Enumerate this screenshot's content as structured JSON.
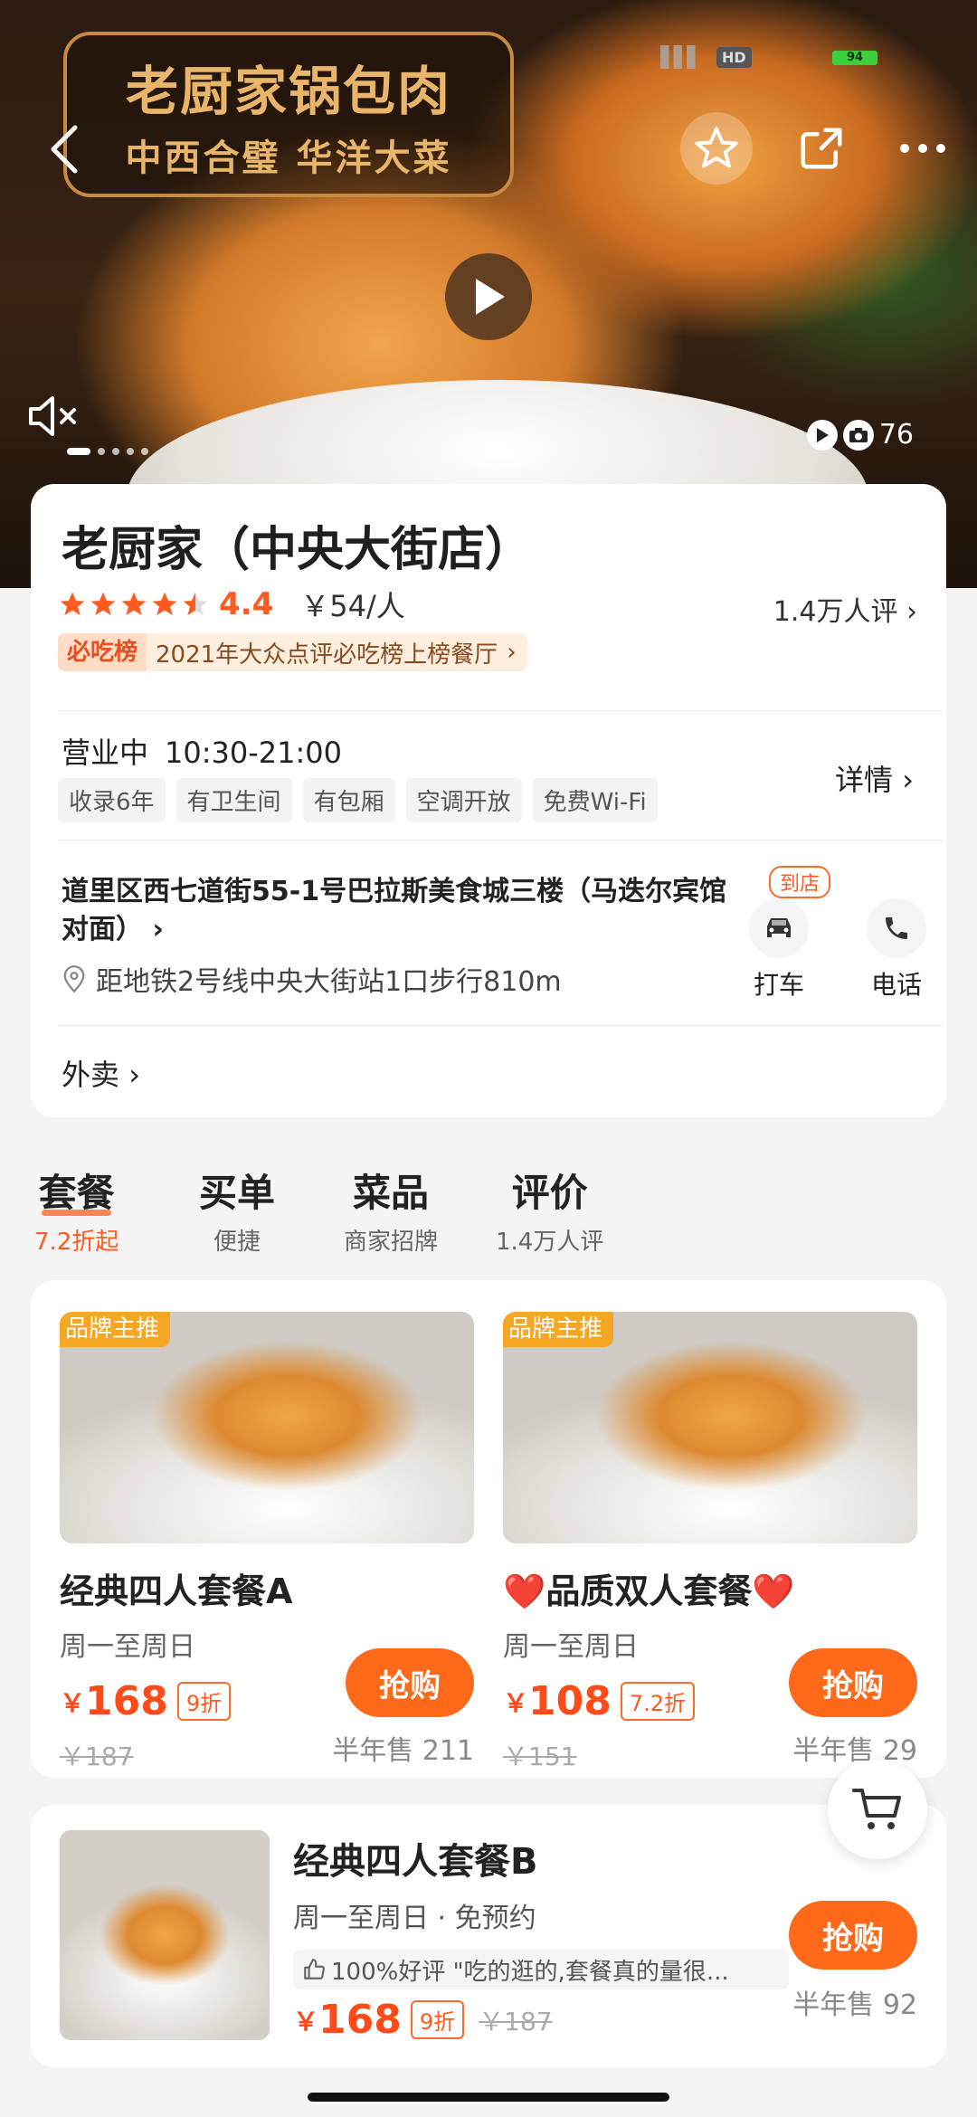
{
  "hero": {
    "sign_line1": "老厨家锅包肉",
    "sign_line2": "中西合璧 华洋大菜",
    "media_count": "76",
    "status_hd": "HD",
    "status_battery": "94"
  },
  "shop": {
    "name": "老厨家（中央大街店）",
    "rating": "4.4",
    "price": "￥54/人",
    "reviews": "1.4万人评",
    "badge_logo": "必吃榜",
    "badge_text": "2021年大众点评必吃榜上榜餐厅",
    "status": "营业中",
    "hours": "10:30-21:00",
    "tags": [
      "收录6年",
      "有卫生间",
      "有包厢",
      "空调开放",
      "免费Wi-Fi"
    ],
    "detail_label": "详情",
    "address": "道里区西七道街55-1号巴拉斯美食城三楼（马迭尔宾馆对面）",
    "metro": "距地铁2号线中央大街站1口步行810m",
    "daodian": "到店",
    "taxi_label": "打车",
    "phone_label": "电话",
    "takeout": "外卖"
  },
  "tabs": [
    {
      "label": "套餐",
      "sub": "7.2折起"
    },
    {
      "label": "买单",
      "sub": "便捷"
    },
    {
      "label": "菜品",
      "sub": "商家招牌"
    },
    {
      "label": "评价",
      "sub": "1.4万人评"
    }
  ],
  "deals": [
    {
      "tag": "品牌主推",
      "title": "经典四人套餐A",
      "days": "周一至周日",
      "currency": "￥",
      "price": "168",
      "discount": "9折",
      "original": "￥187",
      "buy": "抢购",
      "sold": "半年售 211"
    },
    {
      "tag": "品牌主推",
      "title": "❤️品质双人套餐❤️",
      "days": "周一至周日",
      "currency": "￥",
      "price": "108",
      "discount": "7.2折",
      "original": "￥151",
      "buy": "抢购",
      "sold": "半年售 29"
    }
  ],
  "deal3": {
    "title": "经典四人套餐B",
    "days": "周一至周日 · 免预约",
    "review": "100%好评 \"吃的逛的,套餐真的量很...",
    "currency": "￥",
    "price": "168",
    "discount": "9折",
    "original": "￥187",
    "buy": "抢购",
    "sold": "半年售 92"
  }
}
